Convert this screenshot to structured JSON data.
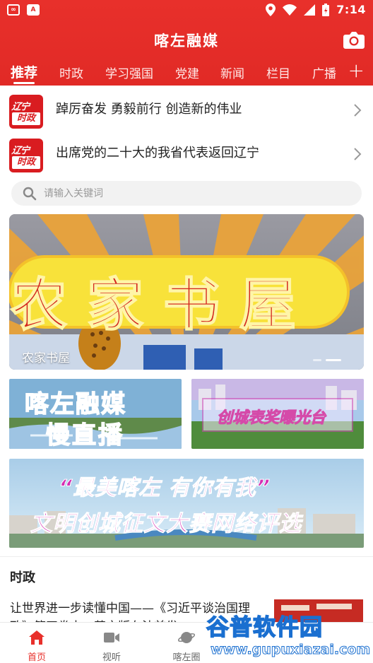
{
  "status_bar": {
    "time": "7:14",
    "left_badges": [
      "∞",
      "A"
    ]
  },
  "header": {
    "title": "喀左融媒",
    "tabs": [
      {
        "label": "推荐",
        "active": true
      },
      {
        "label": "时政"
      },
      {
        "label": "学习强国"
      },
      {
        "label": "党建"
      },
      {
        "label": "新闻"
      },
      {
        "label": "栏目"
      },
      {
        "label": "广播"
      }
    ],
    "add_symbol": "+"
  },
  "news": [
    {
      "logo_top": "辽宁",
      "logo_bottom": "时政",
      "title": "踔厉奋发 勇毅前行 创造新的伟业"
    },
    {
      "logo_top": "辽宁",
      "logo_bottom": "时政",
      "title": "出席党的二十大的我省代表返回辽宁"
    }
  ],
  "search": {
    "placeholder": "请输入关键词"
  },
  "banner": {
    "art_text": [
      "农",
      "家",
      "书",
      "屋"
    ],
    "caption": "农家书屋",
    "slide_count": 2,
    "active_slide": 1
  },
  "promos": {
    "left": {
      "line1": "喀左融媒",
      "line2": "慢直播"
    },
    "right": {
      "text": "创城表奖曝光台"
    },
    "wide": {
      "line1": "“最美喀左 有你有我”",
      "line2": "文明创城征文大赛网络评选"
    }
  },
  "section": {
    "title": "时政",
    "article_title": "让世界进一步读懂中国——《习近平谈治国理政》第四卷中、英文版在法首发"
  },
  "bottom_nav": [
    {
      "label": "首页",
      "icon": "home-icon",
      "active": true
    },
    {
      "label": "视听",
      "icon": "video-icon"
    },
    {
      "label": "喀左圈",
      "icon": "planet-icon"
    }
  ],
  "watermark": {
    "title": "谷普软件园",
    "url": "www.gupuxiazai.com"
  },
  "colors": {
    "brand_red": "#e8302b",
    "text": "#222222",
    "muted": "#9a9a9a"
  }
}
